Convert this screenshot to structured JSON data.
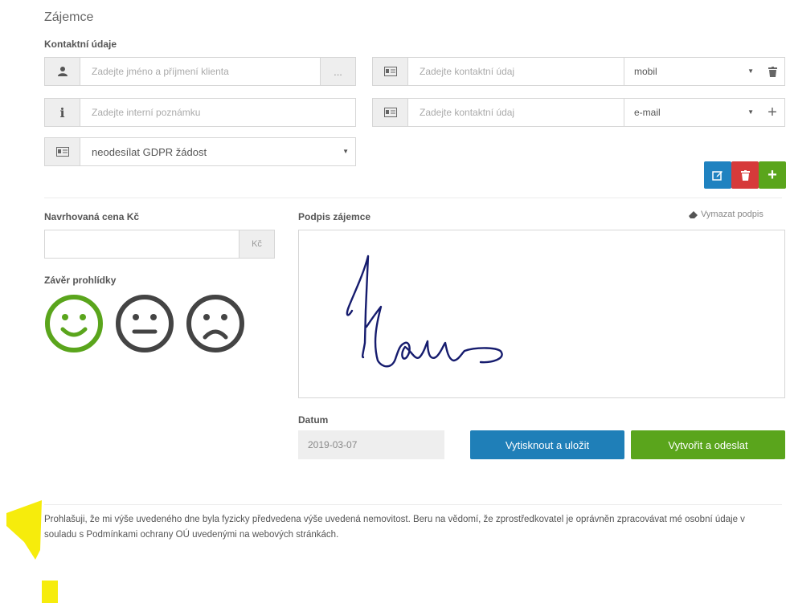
{
  "section_title": "Zájemce",
  "contact": {
    "label": "Kontaktní údaje",
    "name_placeholder": "Zadejte jméno a příjmení klienta",
    "name_addon": "...",
    "note_placeholder": "Zadejte interní poznámku",
    "gdpr_select": "neodesílat GDPR žádost",
    "contacts": [
      {
        "placeholder": "Zadejte kontaktní údaj",
        "type": "mobil",
        "action_icon": "trash-icon"
      },
      {
        "placeholder": "Zadejte kontaktní údaj",
        "type": "e-mail",
        "action_icon": "plus-icon"
      }
    ],
    "action_buttons": [
      {
        "icon": "edit-icon",
        "color": "#1f82c0"
      },
      {
        "icon": "trash-icon",
        "color": "#d63a3a"
      },
      {
        "icon": "plus-icon",
        "color": "#5aa51c"
      }
    ]
  },
  "price": {
    "label": "Navrhovaná cena Kč",
    "value": "",
    "currency": "Kč"
  },
  "conclusion": {
    "label": "Závěr prohlídky",
    "options": [
      "happy",
      "neutral",
      "sad"
    ],
    "selected": "happy",
    "selected_color": "#5aa51c",
    "default_color": "#444444"
  },
  "signature": {
    "label": "Podpis zájemce",
    "clear_label": "Vymazat podpis"
  },
  "date": {
    "label": "Datum",
    "value": "2019-03-07"
  },
  "buttons": {
    "print_save": "Vytisknout a uložit",
    "create_send": "Vytvořit a odeslat",
    "print_color": "#1f7fb8",
    "create_color": "#5aa51c"
  },
  "declaration": "Prohlašuji, že mi výše uvedeného dne byla fyzicky předvedena výše uvedená nemovitost. Beru na vědomí, že zprostředkovatel je oprávněn zpracovávat mé osobní údaje v souladu s Podmínkami ochrany OÚ uvedenými na webových stránkách."
}
